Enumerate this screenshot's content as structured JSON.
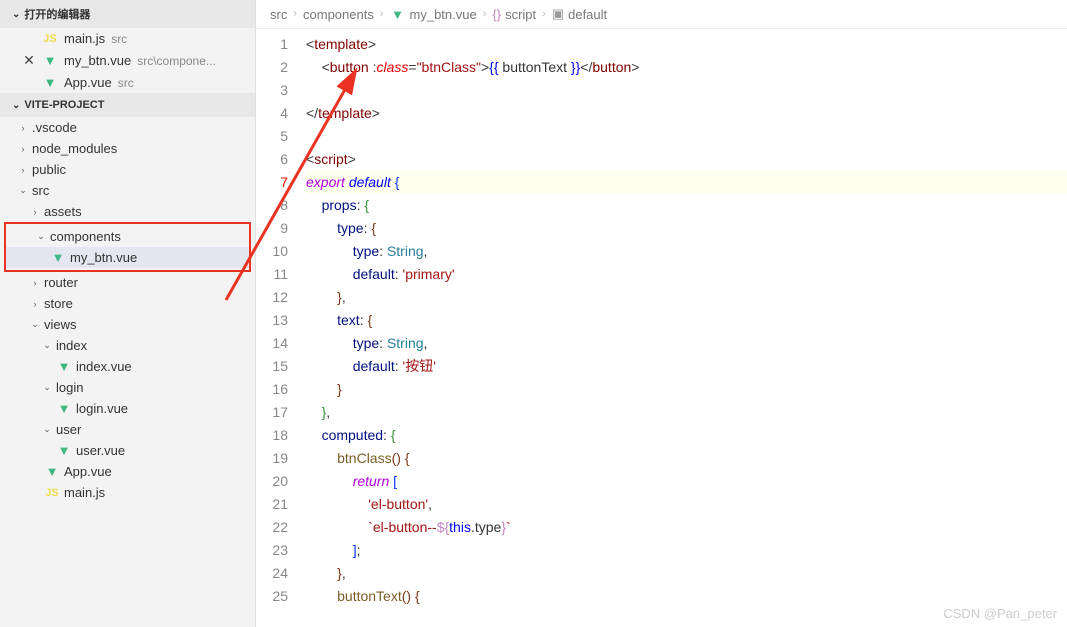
{
  "sections": {
    "open_editors": "打开的编辑器",
    "project": "VITE-PROJECT"
  },
  "open_editors": [
    {
      "icon": "js",
      "name": "main.js",
      "path": "src",
      "close": false
    },
    {
      "icon": "vue",
      "name": "my_btn.vue",
      "path": "src\\compone...",
      "close": true
    },
    {
      "icon": "vue",
      "name": "App.vue",
      "path": "src",
      "close": false
    }
  ],
  "tree": [
    {
      "depth": 1,
      "chev": "›",
      "name": ".vscode"
    },
    {
      "depth": 1,
      "chev": "›",
      "name": "node_modules"
    },
    {
      "depth": 1,
      "chev": "›",
      "name": "public"
    },
    {
      "depth": 1,
      "chev": "⌄",
      "name": "src"
    },
    {
      "depth": 2,
      "chev": "›",
      "name": "assets"
    }
  ],
  "tree_highlight": [
    {
      "depth": 2,
      "chev": "⌄",
      "name": "components"
    },
    {
      "depth": 2,
      "chev": "",
      "icon": "vue",
      "name": "my_btn.vue",
      "active": true
    }
  ],
  "tree2": [
    {
      "depth": 2,
      "chev": "›",
      "name": "router"
    },
    {
      "depth": 2,
      "chev": "›",
      "name": "store"
    },
    {
      "depth": 2,
      "chev": "⌄",
      "name": "views"
    },
    {
      "depth": 3,
      "chev": "⌄",
      "name": "index"
    },
    {
      "depth": 3,
      "chev": "",
      "icon": "vue",
      "name": "index.vue"
    },
    {
      "depth": 3,
      "chev": "⌄",
      "name": "login"
    },
    {
      "depth": 3,
      "chev": "",
      "icon": "vue",
      "name": "login.vue"
    },
    {
      "depth": 3,
      "chev": "⌄",
      "name": "user"
    },
    {
      "depth": 3,
      "chev": "",
      "icon": "vue",
      "name": "user.vue"
    },
    {
      "depth": 2,
      "chev": "",
      "icon": "vue",
      "name": "App.vue"
    },
    {
      "depth": 2,
      "chev": "",
      "icon": "js",
      "name": "main.js"
    }
  ],
  "breadcrumb": [
    {
      "label": "src"
    },
    {
      "label": "components"
    },
    {
      "label": "my_btn.vue",
      "icon": "vue"
    },
    {
      "label": "script",
      "braces": true
    },
    {
      "label": "default",
      "cube": true
    }
  ],
  "code": {
    "l1": {
      "n": "1",
      "html": "<span class='t-punc'>&lt;</span><span class='t-tag'>template</span><span class='t-punc'>&gt;</span>"
    },
    "l2": {
      "n": "2",
      "html": "    <span class='t-punc'>&lt;</span><span class='t-tag'>button</span> <span class='t-punc'>:</span><span class='t-attr'>class</span><span class='t-punc'>=</span><span class='t-str'>\"btnClass\"</span><span class='t-punc'>&gt;</span><span class='t-delim'>{{</span> buttonText <span class='t-delim'>}}</span><span class='t-punc'>&lt;/</span><span class='t-tag'>button</span><span class='t-punc'>&gt;</span>"
    },
    "l3": {
      "n": "3",
      "html": ""
    },
    "l4": {
      "n": "4",
      "html": "<span class='t-punc'>&lt;/</span><span class='t-tag'>template</span><span class='t-punc'>&gt;</span>"
    },
    "l5": {
      "n": "5",
      "html": ""
    },
    "l6": {
      "n": "6",
      "html": "<span class='t-punc'>&lt;</span><span class='t-tag'>script</span><span class='t-punc'>&gt;</span>"
    },
    "l7": {
      "n": "7",
      "html": "<span class='t-kw2'>export</span> <span class='t-kw'>default</span> <span class='t-br1'>{</span>",
      "err": true,
      "hl": true
    },
    "l8": {
      "n": "8",
      "html": "    <span class='t-prop'>props</span>: <span class='t-br2'>{</span>"
    },
    "l9": {
      "n": "9",
      "html": "        <span class='t-prop'>type</span>: <span class='t-br3'>{</span>"
    },
    "l10": {
      "n": "10",
      "html": "            <span class='t-prop'>type</span>: <span class='t-teal'>String</span>,"
    },
    "l11": {
      "n": "11",
      "html": "            <span class='t-prop'>default</span>: <span class='t-str'>'primary'</span>"
    },
    "l12": {
      "n": "12",
      "html": "        <span class='t-br3'>}</span>,"
    },
    "l13": {
      "n": "13",
      "html": "        <span class='t-prop'>text</span>: <span class='t-br3'>{</span>"
    },
    "l14": {
      "n": "14",
      "html": "            <span class='t-prop'>type</span>: <span class='t-teal'>String</span>,"
    },
    "l15": {
      "n": "15",
      "html": "            <span class='t-prop'>default</span>: <span class='t-str'>'按钮'</span>"
    },
    "l16": {
      "n": "16",
      "html": "        <span class='t-br3'>}</span>"
    },
    "l17": {
      "n": "17",
      "html": "    <span class='t-br2'>}</span>,"
    },
    "l18": {
      "n": "18",
      "html": "    <span class='t-prop'>computed</span>: <span class='t-br2'>{</span>"
    },
    "l19": {
      "n": "19",
      "html": "        <span class='t-func'>btnClass</span><span class='t-br3'>()</span> <span class='t-br3'>{</span>"
    },
    "l20": {
      "n": "20",
      "html": "            <span class='t-kw2'>return</span> <span class='t-br1'>[</span>"
    },
    "l21": {
      "n": "21",
      "html": "                <span class='t-str'>'el-button'</span>,"
    },
    "l22": {
      "n": "22",
      "html": "                <span class='t-str'>`el-button--</span><span class='t-brp'>${</span><span class='t-this'>this</span>.type<span class='t-brp'>}</span><span class='t-str'>`</span>"
    },
    "l23": {
      "n": "23",
      "html": "            <span class='t-br1'>]</span>;"
    },
    "l24": {
      "n": "24",
      "html": "        <span class='t-br3'>}</span>,"
    },
    "l25": {
      "n": "25",
      "html": "        <span class='t-func'>buttonText</span><span class='t-br3'>()</span> <span class='t-br3'>{</span>"
    }
  },
  "watermark": "CSDN @Pan_peter"
}
